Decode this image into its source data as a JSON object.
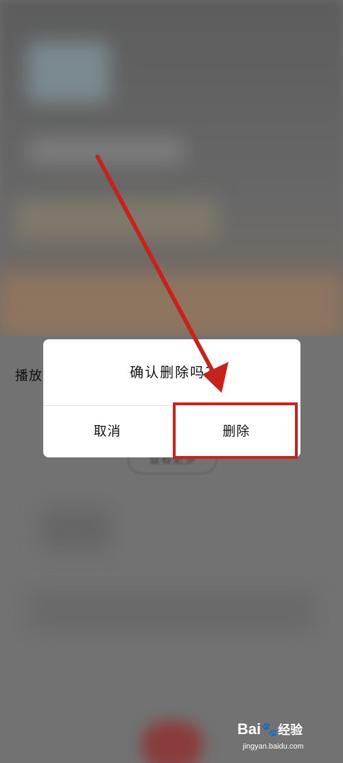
{
  "background": {
    "partial_label": "播放",
    "more_button_label": "查看更多"
  },
  "dialog": {
    "title": "确认删除吗?",
    "cancel_label": "取消",
    "delete_label": "删除"
  },
  "annotation": {
    "color": "#c8221c"
  },
  "watermark": {
    "brand": "Bai",
    "brand_suffix": "经验",
    "domain": "jingyan.baidu.com"
  }
}
